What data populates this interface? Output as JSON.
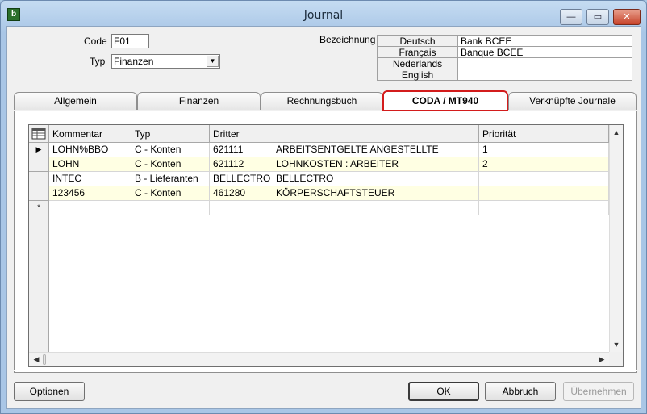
{
  "window": {
    "title": "Journal",
    "icon": "app-icon",
    "icon_glyph": "b",
    "controls": {
      "minimize": "—",
      "maximize": "▭",
      "close": "✕"
    }
  },
  "form": {
    "code_label": "Code",
    "code_value": "F01",
    "typ_label": "Typ",
    "typ_value": "Finanzen",
    "bezeichnung_label": "Bezeichnung",
    "bezeichnung": [
      {
        "lang": "Deutsch",
        "value": "Bank BCEE"
      },
      {
        "lang": "Français",
        "value": "Banque BCEE"
      },
      {
        "lang": "Nederlands",
        "value": ""
      },
      {
        "lang": "English",
        "value": ""
      }
    ]
  },
  "tabs": [
    {
      "label": "Allgemein"
    },
    {
      "label": "Finanzen"
    },
    {
      "label": "Rechnungsbuch"
    },
    {
      "label": "CODA / MT940",
      "active": true
    },
    {
      "label": "Verknüpfte Journale"
    }
  ],
  "grid": {
    "headers": [
      "Kommentar",
      "Typ",
      "Dritter",
      "",
      "Priorität"
    ],
    "rows": [
      {
        "marker": "▶",
        "kommentar": "LOHN%BBO",
        "typ": "C - Konten",
        "dritter_code": "621111",
        "dritter_name": "ARBEITSENTGELTE ANGESTELLTE",
        "prioritaet": "1"
      },
      {
        "marker": "",
        "kommentar": "LOHN",
        "typ": "C - Konten",
        "dritter_code": "621112",
        "dritter_name": "LOHNKOSTEN : ARBEITER",
        "prioritaet": "2"
      },
      {
        "marker": "",
        "kommentar": "INTEC",
        "typ": "B - Lieferanten",
        "dritter_code": "BELLECTRO",
        "dritter_name": "BELLECTRO",
        "prioritaet": ""
      },
      {
        "marker": "",
        "kommentar": "123456",
        "typ": "C - Konten",
        "dritter_code": "461280",
        "dritter_name": "KÖRPERSCHAFTSTEUER",
        "prioritaet": ""
      },
      {
        "marker": "*",
        "kommentar": "",
        "typ": "",
        "dritter_code": "",
        "dritter_name": "",
        "prioritaet": ""
      }
    ]
  },
  "buttons": {
    "optionen": "Optionen",
    "ok": "OK",
    "abbruch": "Abbruch",
    "uebernehmen": "Übernehmen"
  },
  "glyphs": {
    "dropdown": "▼",
    "up": "▲",
    "down": "▼",
    "left": "◀",
    "right": "▶"
  },
  "colors": {
    "active_tab_border": "#d31c1c",
    "row_alt": "#ffffe3"
  }
}
